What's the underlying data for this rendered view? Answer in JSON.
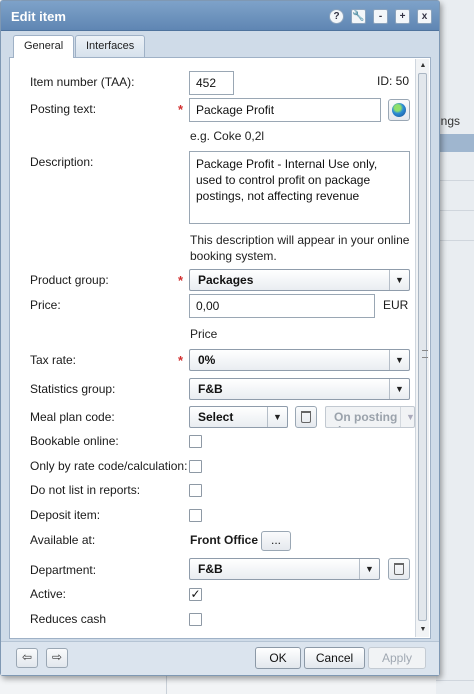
{
  "background": {
    "right_text": "ings"
  },
  "window": {
    "title": "Edit item",
    "controls": {
      "help": "?",
      "tools": "🔧",
      "minimize": "-",
      "maximize": "+",
      "close": "x"
    }
  },
  "tabs": [
    {
      "label": "General",
      "active": true
    },
    {
      "label": "Interfaces",
      "active": false
    }
  ],
  "form": {
    "item_number": {
      "label": "Item number (TAA):",
      "value": "452",
      "id_text": "ID: 50"
    },
    "posting_text": {
      "label": "Posting text:",
      "value": "Package Profit",
      "hint": "e.g. Coke 0,2l"
    },
    "description": {
      "label": "Description:",
      "value": "Package Profit - Internal Use only, used to control profit on package postings, not affecting revenue",
      "hint": "This description will appear in your online booking system."
    },
    "product_group": {
      "label": "Product group:",
      "value": "Packages"
    },
    "price": {
      "label": "Price:",
      "value": "0,00",
      "currency": "EUR",
      "hint": "Price"
    },
    "tax_rate": {
      "label": "Tax rate:",
      "value": "0%"
    },
    "statistics_group": {
      "label": "Statistics group:",
      "value": "F&B"
    },
    "meal_plan_code": {
      "label": "Meal plan code:",
      "value": "Select",
      "posting_value": "On posting d"
    },
    "bookable_online": {
      "label": "Bookable online:",
      "checked": false
    },
    "only_by_rate_code": {
      "label": "Only by rate code/calculation:",
      "checked": false
    },
    "do_not_list": {
      "label": "Do not list in reports:",
      "checked": false
    },
    "deposit_item": {
      "label": "Deposit item:",
      "checked": false
    },
    "available_at": {
      "label": "Available at:",
      "value": "Front Office",
      "button": "..."
    },
    "department": {
      "label": "Department:",
      "value": "F&B"
    },
    "active": {
      "label": "Active:",
      "checked": true,
      "mark": "✓"
    },
    "reduces_cash": {
      "label": "Reduces cash",
      "checked": false
    }
  },
  "footer": {
    "back": "⇦",
    "forward": "⇨",
    "ok": "OK",
    "cancel": "Cancel",
    "apply": "Apply"
  },
  "colors": {
    "titlebar": "#6a8fbb",
    "required": "#d23030"
  }
}
